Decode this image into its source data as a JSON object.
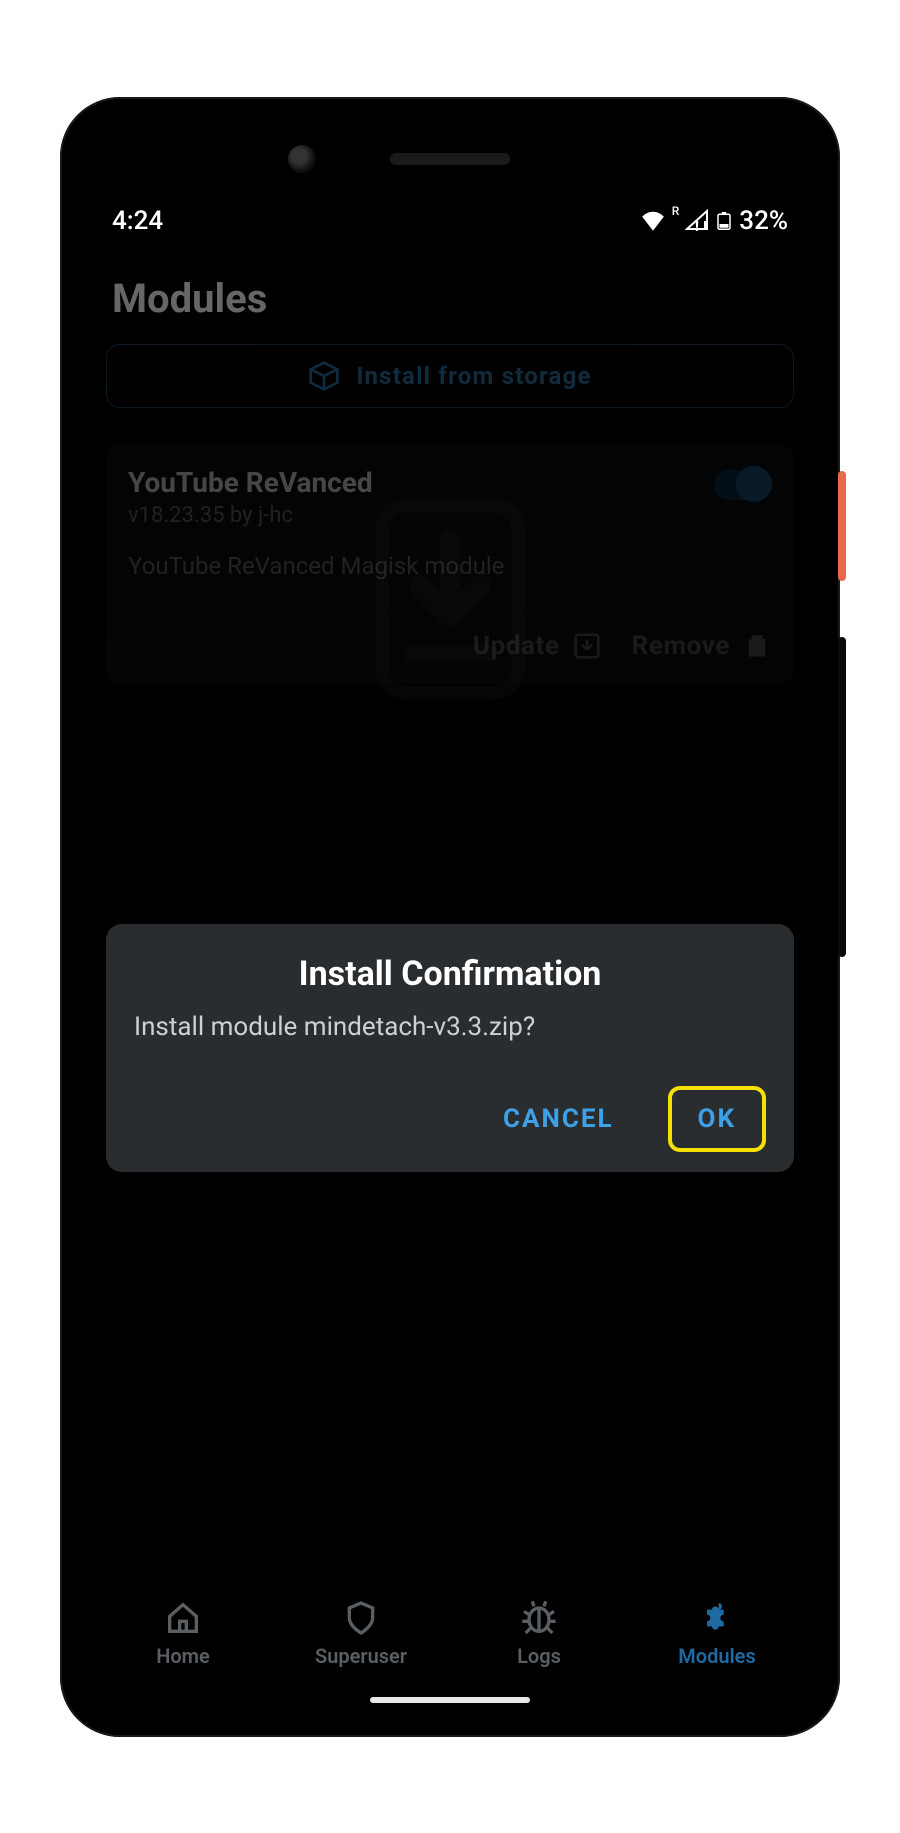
{
  "statusbar": {
    "time": "4:24",
    "roaming": "R",
    "battery_pct": "32%"
  },
  "header": {
    "title": "Modules"
  },
  "install_button": {
    "label": "Install from storage"
  },
  "module": {
    "title": "YouTube ReVanced",
    "subtitle": "v18.23.35 by j-hc",
    "description": "YouTube ReVanced Magisk module",
    "enabled": true,
    "actions": {
      "update": "Update",
      "remove": "Remove"
    }
  },
  "dialog": {
    "title": "Install Confirmation",
    "message": "Install module mindetach-v3.3.zip?",
    "cancel": "CANCEL",
    "ok": "OK"
  },
  "nav": {
    "home": "Home",
    "superuser": "Superuser",
    "logs": "Logs",
    "modules": "Modules"
  }
}
